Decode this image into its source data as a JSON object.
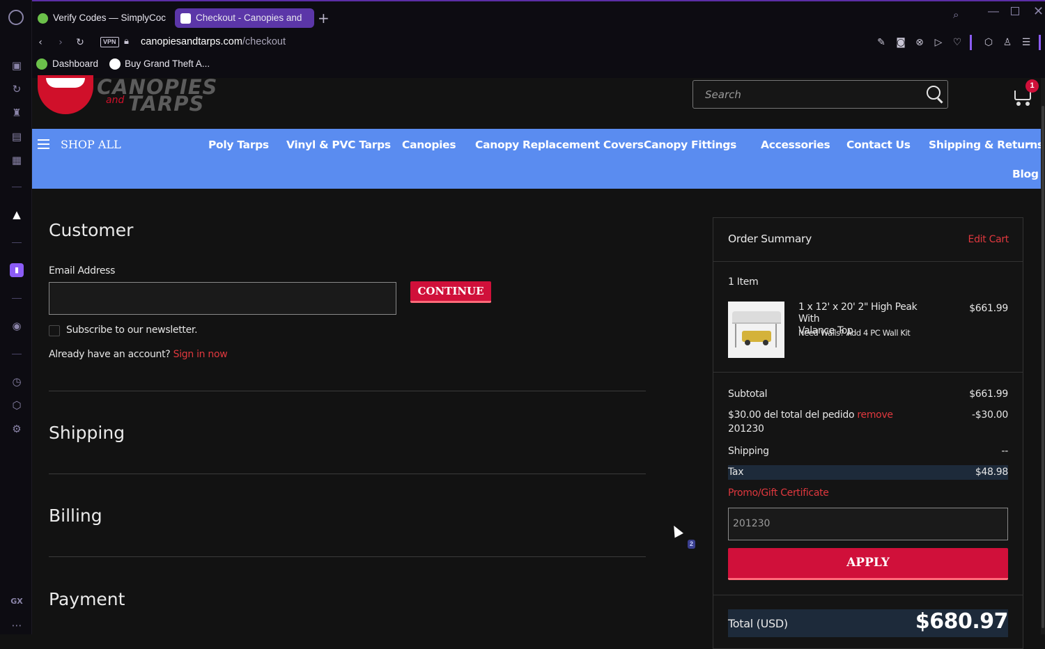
{
  "browser": {
    "tabs": [
      {
        "label": "Verify Codes — SimplyCoc",
        "active": false
      },
      {
        "label": "Checkout - Canopies and",
        "active": true
      }
    ],
    "address": {
      "vpn": "VPN",
      "domain": "canopiesandtarps.com",
      "path": "/checkout"
    },
    "bookmarks": [
      {
        "label": "Dashboard"
      },
      {
        "label": "Buy Grand Theft A..."
      }
    ],
    "sidebar_bottom_label": "GX"
  },
  "site": {
    "logo_text_top": "CANOPIES",
    "logo_text_and": "and",
    "logo_text_bottom": "TARPS",
    "search_placeholder": "Search",
    "cart_count": "1",
    "colors": {
      "nav_bg": "#5a8cf0",
      "accent_red": "#d0103a",
      "link_red": "#e0383e"
    }
  },
  "nav": {
    "shop_all": "SHOP ALL",
    "links": [
      {
        "label": "Poly Tarps"
      },
      {
        "label": "Vinyl & PVC Tarps"
      },
      {
        "label": "Canopies"
      },
      {
        "label": "Canopy Replacement Covers"
      },
      {
        "label": "Canopy Fittings"
      },
      {
        "label": "Accessories"
      },
      {
        "label": "Contact Us"
      },
      {
        "label": "Shipping & Returns"
      }
    ],
    "blog": "Blog"
  },
  "checkout": {
    "customer_title": "Customer",
    "email_label": "Email Address",
    "email_value": "",
    "continue_label": "CONTINUE",
    "newsletter_label": "Subscribe to our newsletter.",
    "account_prompt": "Already have an account?",
    "sign_in_link": "Sign in now",
    "shipping_title": "Shipping",
    "billing_title": "Billing",
    "payment_title": "Payment"
  },
  "summary": {
    "title": "Order Summary",
    "edit_cart": "Edit Cart",
    "items_count": "1 Item",
    "item_name_line1": "1 x 12' x 20' 2\" High Peak With",
    "item_name_line2": "Valance Top",
    "item_option": "Need Walls? Add 4 PC Wall Kit",
    "item_price": "$661.99",
    "subtotal_label": "Subtotal",
    "subtotal_value": "$661.99",
    "discount_label": "$30.00 del total del pedido",
    "discount_remove": "remove",
    "discount_code": "201230",
    "discount_value": "-$30.00",
    "shipping_label": "Shipping",
    "shipping_value": "--",
    "tax_label": "Tax",
    "tax_value": "$48.98",
    "promo_label": "Promo/Gift Certificate",
    "promo_value": "201230",
    "apply_label": "APPLY",
    "total_label": "Total (USD)",
    "total_value": "$680.97"
  },
  "overlay": {
    "badge": "2"
  }
}
